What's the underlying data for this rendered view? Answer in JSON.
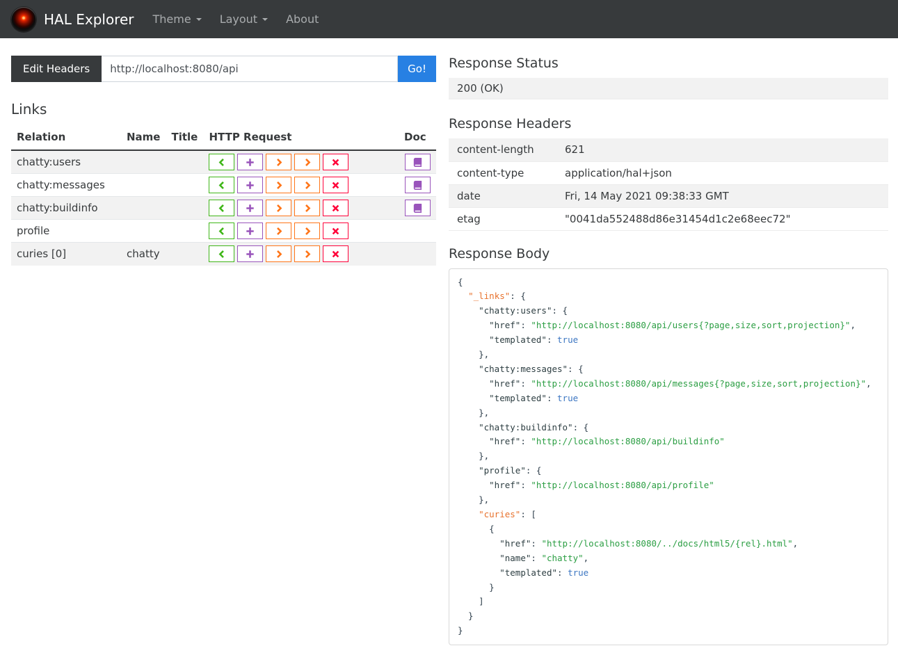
{
  "navbar": {
    "brand": "HAL Explorer",
    "items": [
      {
        "label": "Theme",
        "dropdown": true
      },
      {
        "label": "Layout",
        "dropdown": true
      },
      {
        "label": "About",
        "dropdown": false
      }
    ]
  },
  "request_bar": {
    "edit_headers_label": "Edit Headers",
    "url_value": "http://localhost:8080/api",
    "go_label": "Go!"
  },
  "links_section": {
    "title": "Links",
    "columns": [
      "Relation",
      "Name",
      "Title",
      "HTTP Request",
      "Doc"
    ],
    "http_buttons": [
      {
        "method": "get",
        "glyph": "chevron-left-icon",
        "color": "#3fb618"
      },
      {
        "method": "post",
        "glyph": "plus-icon",
        "color": "#9954bb"
      },
      {
        "method": "put",
        "glyph": "chevron-right-icon",
        "color": "#ff7518"
      },
      {
        "method": "patch",
        "glyph": "chevron-right-icon",
        "color": "#ff7518"
      },
      {
        "method": "delete",
        "glyph": "x-icon",
        "color": "#ff0039"
      }
    ],
    "doc_button_color": "#9954bb",
    "rows": [
      {
        "relation": "chatty:users",
        "name": "",
        "title": "",
        "doc": true
      },
      {
        "relation": "chatty:messages",
        "name": "",
        "title": "",
        "doc": true
      },
      {
        "relation": "chatty:buildinfo",
        "name": "",
        "title": "",
        "doc": true
      },
      {
        "relation": "profile",
        "name": "",
        "title": "",
        "doc": false
      },
      {
        "relation": "curies [0]",
        "name": "chatty",
        "title": "",
        "doc": false
      }
    ]
  },
  "response_status": {
    "title": "Response Status",
    "value": "200 (OK)"
  },
  "response_headers": {
    "title": "Response Headers",
    "rows": [
      {
        "name": "content-length",
        "value": "621"
      },
      {
        "name": "content-type",
        "value": "application/hal+json"
      },
      {
        "name": "date",
        "value": "Fri, 14 May 2021 09:38:33 GMT"
      },
      {
        "name": "etag",
        "value": "\"0041da552488d86e31454d1c2e68eec72\""
      }
    ]
  },
  "response_body": {
    "title": "Response Body",
    "lines": [
      [
        [
          "p",
          "{"
        ]
      ],
      [
        [
          "p",
          "  "
        ],
        [
          "s",
          "\"_links\""
        ],
        [
          "p",
          ": {"
        ]
      ],
      [
        [
          "p",
          "    "
        ],
        [
          "k",
          "\"chatty:users\""
        ],
        [
          "p",
          ": {"
        ]
      ],
      [
        [
          "p",
          "      "
        ],
        [
          "k",
          "\"href\""
        ],
        [
          "p",
          ": "
        ],
        [
          "g",
          "\"http://localhost:8080/api/users{?page,size,sort,projection}\""
        ],
        [
          "p",
          ","
        ]
      ],
      [
        [
          "p",
          "      "
        ],
        [
          "k",
          "\"templated\""
        ],
        [
          "p",
          ": "
        ],
        [
          "b",
          "true"
        ]
      ],
      [
        [
          "p",
          "    },"
        ]
      ],
      [
        [
          "p",
          "    "
        ],
        [
          "k",
          "\"chatty:messages\""
        ],
        [
          "p",
          ": {"
        ]
      ],
      [
        [
          "p",
          "      "
        ],
        [
          "k",
          "\"href\""
        ],
        [
          "p",
          ": "
        ],
        [
          "g",
          "\"http://localhost:8080/api/messages{?page,size,sort,projection}\""
        ],
        [
          "p",
          ","
        ]
      ],
      [
        [
          "p",
          "      "
        ],
        [
          "k",
          "\"templated\""
        ],
        [
          "p",
          ": "
        ],
        [
          "b",
          "true"
        ]
      ],
      [
        [
          "p",
          "    },"
        ]
      ],
      [
        [
          "p",
          "    "
        ],
        [
          "k",
          "\"chatty:buildinfo\""
        ],
        [
          "p",
          ": {"
        ]
      ],
      [
        [
          "p",
          "      "
        ],
        [
          "k",
          "\"href\""
        ],
        [
          "p",
          ": "
        ],
        [
          "g",
          "\"http://localhost:8080/api/buildinfo\""
        ]
      ],
      [
        [
          "p",
          "    },"
        ]
      ],
      [
        [
          "p",
          "    "
        ],
        [
          "k",
          "\"profile\""
        ],
        [
          "p",
          ": {"
        ]
      ],
      [
        [
          "p",
          "      "
        ],
        [
          "k",
          "\"href\""
        ],
        [
          "p",
          ": "
        ],
        [
          "g",
          "\"http://localhost:8080/api/profile\""
        ]
      ],
      [
        [
          "p",
          "    },"
        ]
      ],
      [
        [
          "p",
          "    "
        ],
        [
          "s",
          "\"curies\""
        ],
        [
          "p",
          ": ["
        ]
      ],
      [
        [
          "p",
          "      {"
        ]
      ],
      [
        [
          "p",
          "        "
        ],
        [
          "k",
          "\"href\""
        ],
        [
          "p",
          ": "
        ],
        [
          "g",
          "\"http://localhost:8080/../docs/html5/{rel}.html\""
        ],
        [
          "p",
          ","
        ]
      ],
      [
        [
          "p",
          "        "
        ],
        [
          "k",
          "\"name\""
        ],
        [
          "p",
          ": "
        ],
        [
          "g",
          "\"chatty\""
        ],
        [
          "p",
          ","
        ]
      ],
      [
        [
          "p",
          "        "
        ],
        [
          "k",
          "\"templated\""
        ],
        [
          "p",
          ": "
        ],
        [
          "b",
          "true"
        ]
      ],
      [
        [
          "p",
          "      }"
        ]
      ],
      [
        [
          "p",
          "    ]"
        ]
      ],
      [
        [
          "p",
          "  }"
        ]
      ],
      [
        [
          "p",
          "}"
        ]
      ]
    ]
  },
  "colors": {
    "navbar_bg": "#373a3c",
    "primary": "#2780e3",
    "success": "#3fb618",
    "info_purple": "#9954bb",
    "warning_orange": "#ff7518",
    "danger": "#ff0039",
    "stripe": "#f2f2f2",
    "code_key": "#2d3e42",
    "code_special_key": "#e8722d",
    "code_string": "#2b9e43",
    "code_bool": "#3c76c2"
  }
}
